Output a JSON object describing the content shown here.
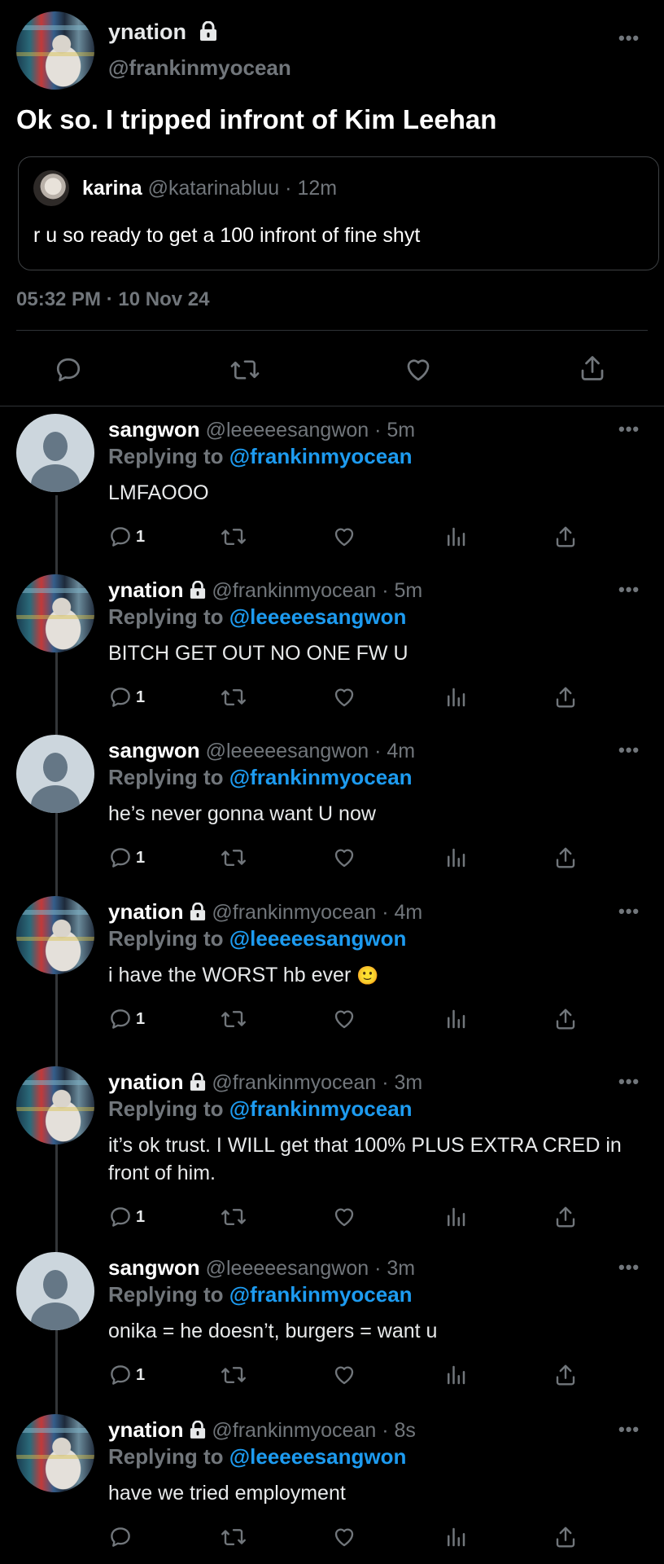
{
  "main_tweet": {
    "display_name": "ynation",
    "handle": "@frankinmyocean",
    "text": "Ok so. I tripped infront of Kim Leehan",
    "timestamp": "05:32 PM · 10 Nov 24",
    "quote": {
      "display_name": "karina",
      "handle": "@katarinabluu",
      "age": "· 12m",
      "text": "r u so ready to get a 100 infront of fine shyt"
    }
  },
  "replying_prefix": "Replying to",
  "replies": [
    {
      "display_name": "sangwon",
      "handle": "@leeeeesangwon",
      "age": "· 5m",
      "replying_to": "@frankinmyocean",
      "text": "LMFAOOO",
      "reply_count": "1"
    },
    {
      "display_name": "ynation",
      "handle": "@frankinmyocean",
      "age": "· 5m",
      "replying_to": "@leeeeesangwon",
      "text": "BITCH GET OUT NO ONE FW U",
      "reply_count": "1"
    },
    {
      "display_name": "sangwon",
      "handle": "@leeeeesangwon",
      "age": "· 4m",
      "replying_to": "@frankinmyocean",
      "text": "he’s never gonna want U now",
      "reply_count": "1"
    },
    {
      "display_name": "ynation",
      "handle": "@frankinmyocean",
      "age": "· 4m",
      "replying_to": "@leeeeesangwon",
      "text": "i have the WORST hb ever",
      "emoji": "🙂",
      "reply_count": "1"
    },
    {
      "display_name": "ynation",
      "handle": "@frankinmyocean",
      "age": "· 3m",
      "replying_to": "@frankinmyocean",
      "text": "it’s ok trust. I WILL get that 100% PLUS EXTRA CRED in front of him.",
      "reply_count": "1"
    },
    {
      "display_name": "sangwon",
      "handle": "@leeeeesangwon",
      "age": "· 3m",
      "replying_to": "@frankinmyocean",
      "text": "onika = he doesn’t, burgers = want u",
      "reply_count": "1"
    },
    {
      "display_name": "ynation",
      "handle": "@frankinmyocean",
      "age": "· 8s",
      "replying_to": "@leeeeesangwon",
      "text": "have we tried employment",
      "reply_count": ""
    }
  ],
  "more_label": "•••",
  "colors": {
    "background": "#000000",
    "accent": "#1d9bf0",
    "muted": "#71767b",
    "text": "#e7e9ea"
  }
}
